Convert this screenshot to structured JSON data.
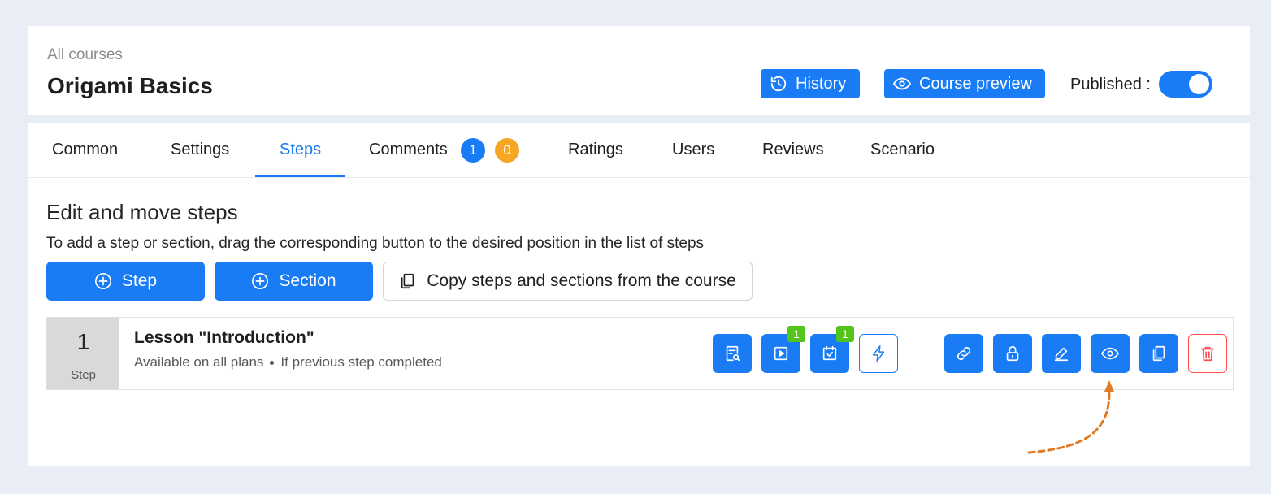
{
  "header": {
    "breadcrumb": "All courses",
    "title": "Origami Basics",
    "history_label": "History",
    "preview_label": "Course preview",
    "published_label": "Published :",
    "published": true
  },
  "tabs": [
    {
      "label": "Common"
    },
    {
      "label": "Settings"
    },
    {
      "label": "Steps",
      "active": true
    },
    {
      "label": "Comments"
    },
    {
      "label": "Ratings"
    },
    {
      "label": "Users"
    },
    {
      "label": "Reviews"
    },
    {
      "label": "Scenario"
    }
  ],
  "comment_badges": {
    "new": "1",
    "pending": "0"
  },
  "section": {
    "title": "Edit and move steps",
    "description": "To add a step or section, drag the corresponding button to the desired position in the list of steps"
  },
  "actions": {
    "step_label": "Step",
    "section_label": "Section",
    "copy_label": "Copy steps and sections from the course"
  },
  "step": {
    "number": "1",
    "kind": "Step",
    "title": "Lesson \"Introduction\"",
    "availability": "Available on all plans",
    "condition": "If previous step completed",
    "video_count": "1",
    "task_count": "1"
  },
  "colors": {
    "primary": "#1a7cf5",
    "danger": "#ff4d4f",
    "success": "#52c41a",
    "warning": "#f5a623",
    "annotation_arrow": "#e07b24"
  }
}
